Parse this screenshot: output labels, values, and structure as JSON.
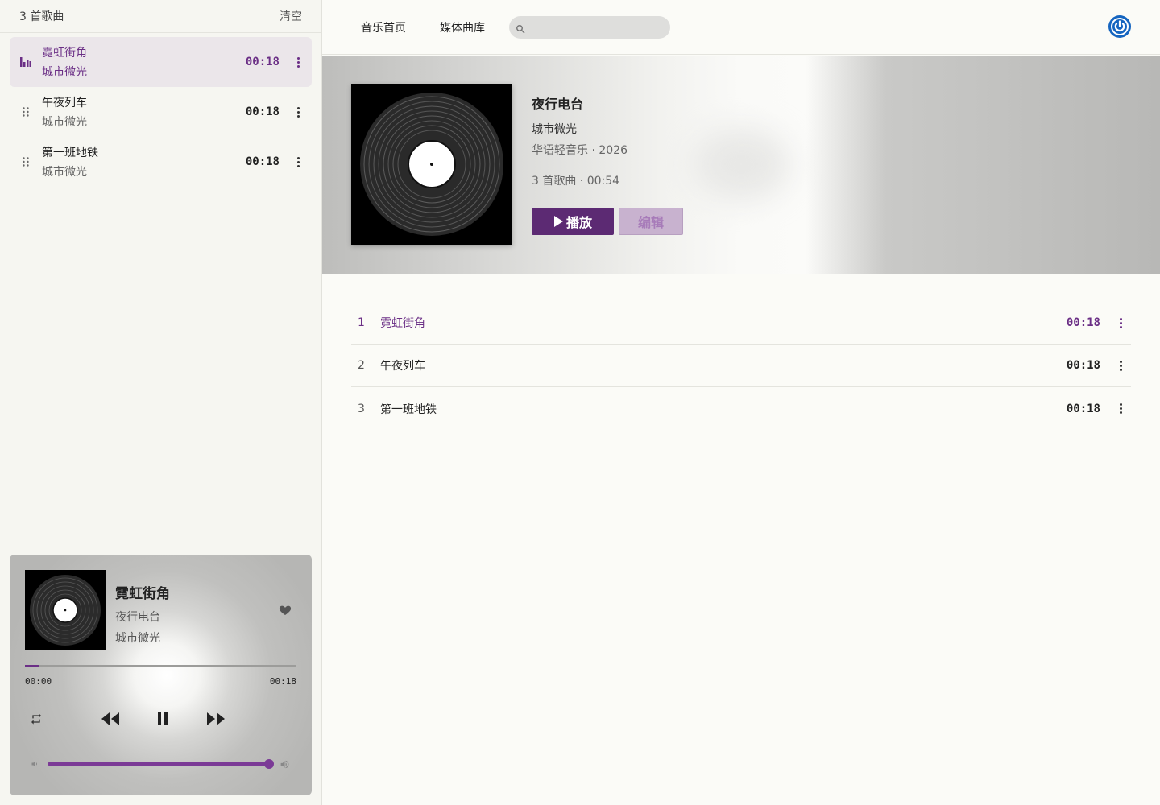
{
  "queue": {
    "count_label": "3 首歌曲",
    "clear_label": "清空",
    "items": [
      {
        "title": "霓虹街角",
        "artist": "城市微光",
        "duration": "00:18",
        "active": true
      },
      {
        "title": "午夜列车",
        "artist": "城市微光",
        "duration": "00:18",
        "active": false
      },
      {
        "title": "第一班地铁",
        "artist": "城市微光",
        "duration": "00:18",
        "active": false
      }
    ]
  },
  "player": {
    "title": "霓虹街角",
    "album": "夜行电台",
    "artist": "城市微光",
    "current_time": "00:00",
    "total_time": "00:18",
    "progress_fraction": 0.05,
    "volume_fraction": 1.0
  },
  "topbar": {
    "nav_home": "音乐首页",
    "nav_library": "媒体曲库",
    "search_value": "",
    "search_placeholder": ""
  },
  "album": {
    "title": "夜行电台",
    "artist": "城市微光",
    "genre_year": "华语轻音乐 · 2026",
    "summary": "3 首歌曲 · 00:54",
    "play_label": "播放",
    "edit_label": "编辑"
  },
  "tracks": [
    {
      "num": "1",
      "title": "霓虹街角",
      "duration": "00:18",
      "active": true
    },
    {
      "num": "2",
      "title": "午夜列车",
      "duration": "00:18",
      "active": false
    },
    {
      "num": "3",
      "title": "第一班地铁",
      "duration": "00:18",
      "active": false
    }
  ],
  "colors": {
    "accent": "#6b2f86",
    "play_button": "#5c2a73",
    "edit_button": "#c8b2cf",
    "power_icon": "#1565c0"
  },
  "icons": {
    "now_playing": "equalizer-icon",
    "drag": "drag-handle-icon",
    "more": "more-vertical-icon",
    "heart": "heart-icon",
    "repeat": "repeat-icon",
    "rewind": "rewind-icon",
    "pause": "pause-icon",
    "forward": "fast-forward-icon",
    "volume_low": "volume-low-icon",
    "volume_high": "volume-high-icon",
    "search": "search-icon",
    "power": "power-icon",
    "play": "play-icon"
  }
}
